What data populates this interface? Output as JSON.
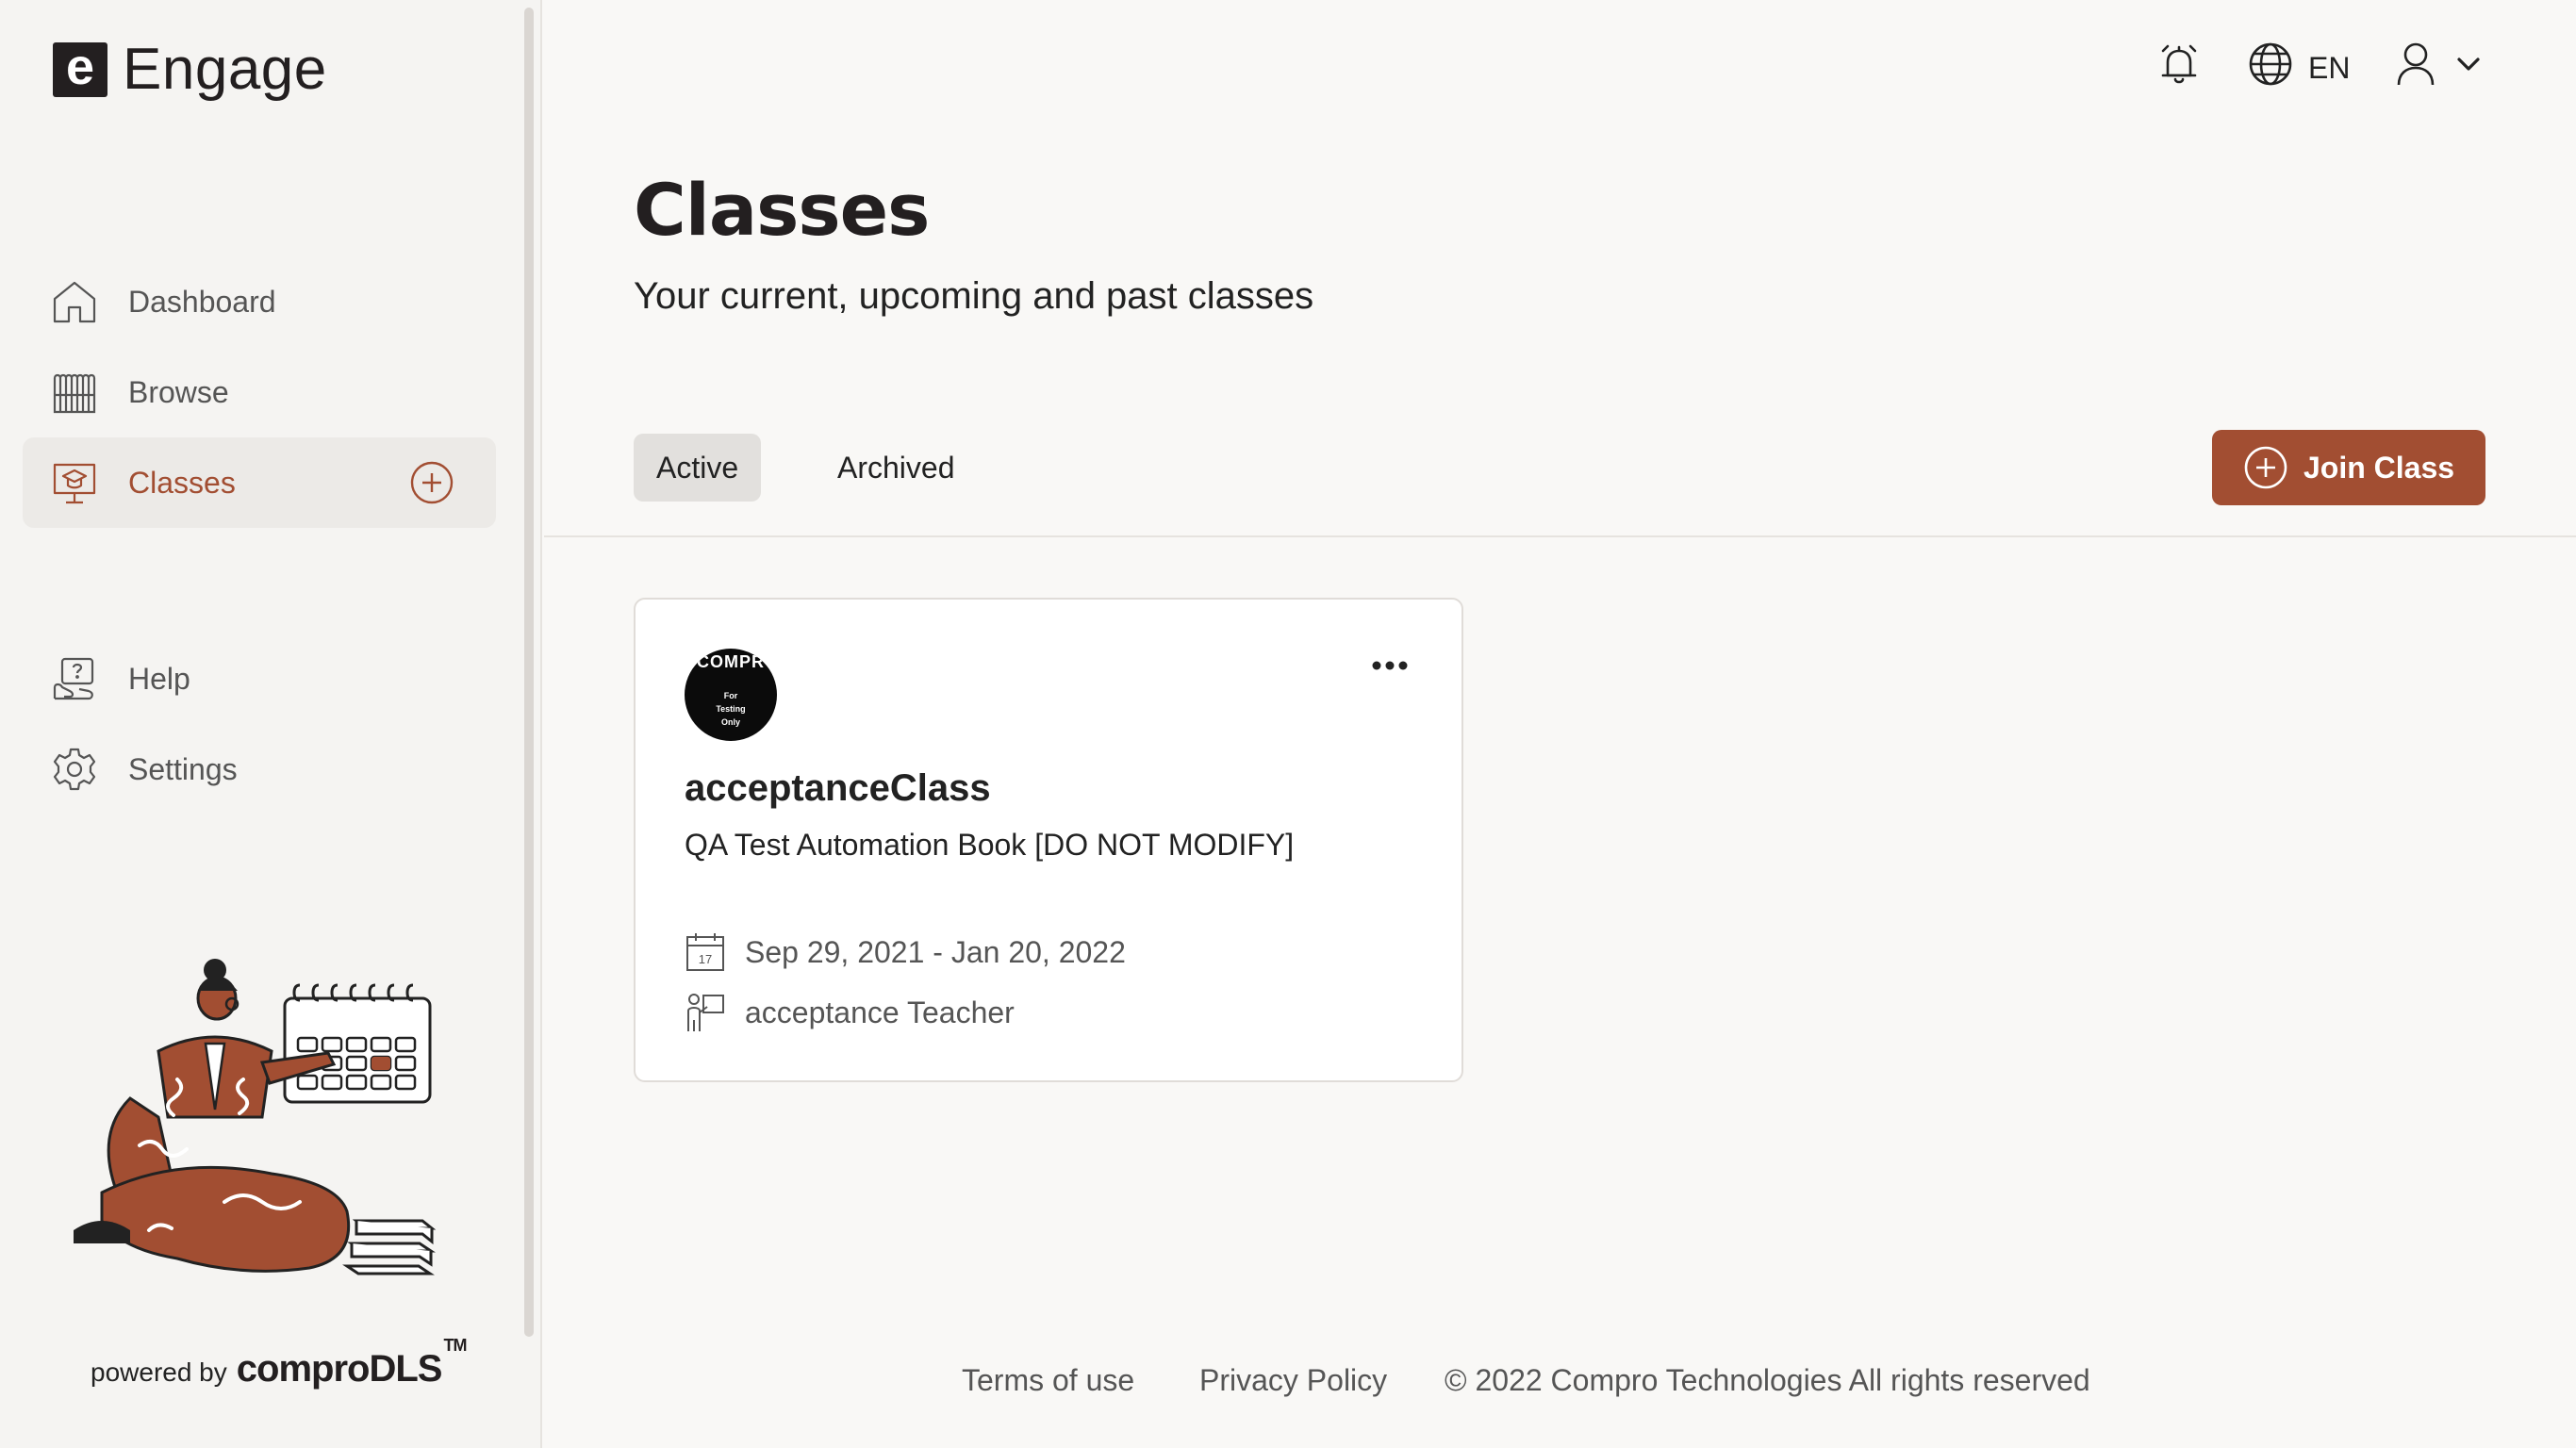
{
  "app": {
    "logo_letter": "e",
    "name": "Engage"
  },
  "sidebar": {
    "items": [
      {
        "label": "Dashboard",
        "icon": "home-icon"
      },
      {
        "label": "Browse",
        "icon": "bookshelf-icon"
      },
      {
        "label": "Classes",
        "icon": "classroom-icon",
        "active": true
      },
      {
        "label": "Help",
        "icon": "help-icon"
      },
      {
        "label": "Settings",
        "icon": "gear-icon"
      }
    ],
    "powered_prefix": "powered by",
    "powered_brand": "comproDLS",
    "powered_tm": "TM"
  },
  "header": {
    "language": "EN",
    "icons": [
      "notification-bell-icon",
      "globe-icon",
      "user-icon",
      "chevron-down-icon"
    ]
  },
  "main": {
    "title": "Classes",
    "subtitle": "Your current, upcoming and past classes",
    "tabs": [
      {
        "label": "Active",
        "selected": true
      },
      {
        "label": "Archived",
        "selected": false
      }
    ],
    "join_button": "Join Class"
  },
  "classes": [
    {
      "avatar_text": "COMPR",
      "avatar_caption": [
        "For",
        "Testing",
        "Only"
      ],
      "name": "acceptanceClass",
      "book": "QA Test Automation Book [DO NOT MODIFY]",
      "dates": "Sep 29, 2021 - Jan 20, 2022",
      "calendar_day": "17",
      "teacher": "acceptance Teacher"
    }
  ],
  "footer": {
    "terms": "Terms of use",
    "privacy": "Privacy Policy",
    "copyright": "© 2022 Compro Technologies All rights reserved"
  },
  "colors": {
    "accent": "#a24e32",
    "background": "#f9f8f6",
    "sidebar": "#f5f4f2",
    "active_bg": "#eceae7"
  }
}
